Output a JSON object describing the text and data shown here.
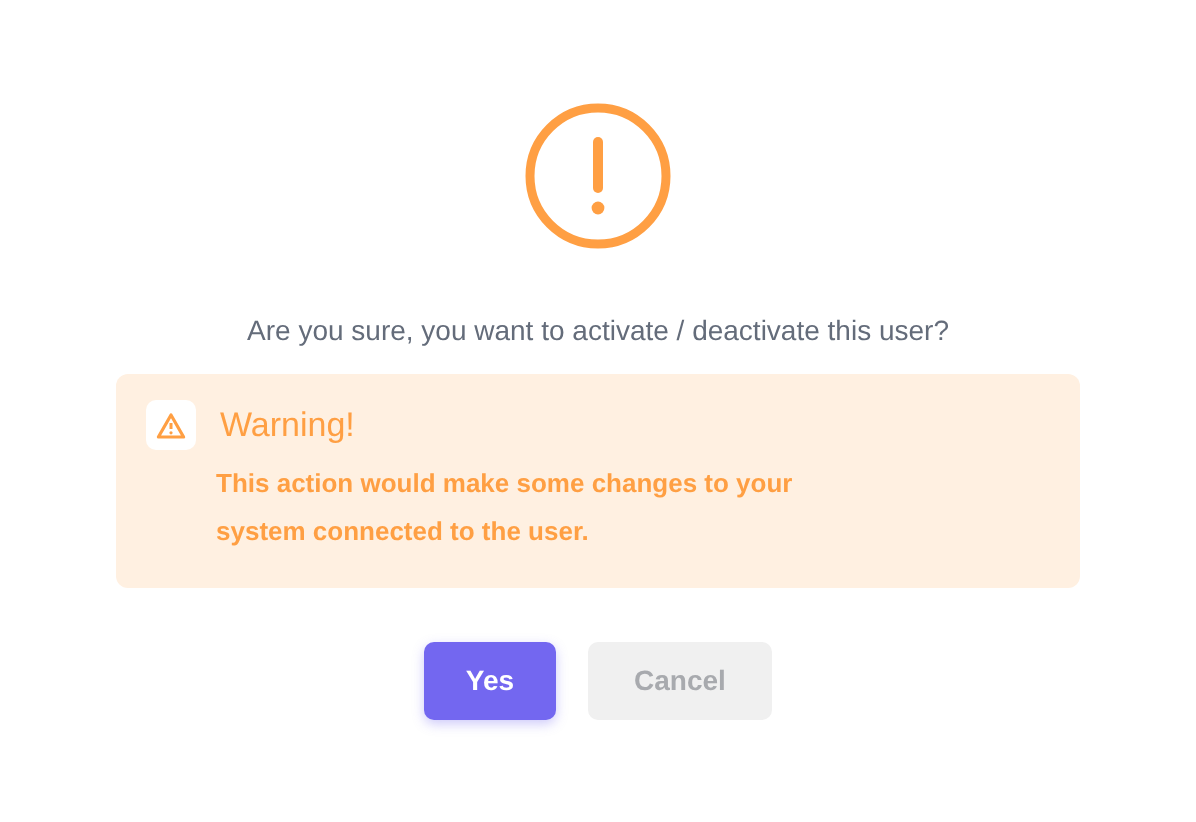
{
  "dialog": {
    "message": "Are you sure, you want to activate / deactivate this user?",
    "alert": {
      "title": "Warning!",
      "text": "This action would make some changes to your system connected to the user."
    },
    "buttons": [
      {
        "label": "Yes",
        "kind": "primary"
      },
      {
        "label": "Cancel",
        "kind": "secondary"
      }
    ]
  }
}
